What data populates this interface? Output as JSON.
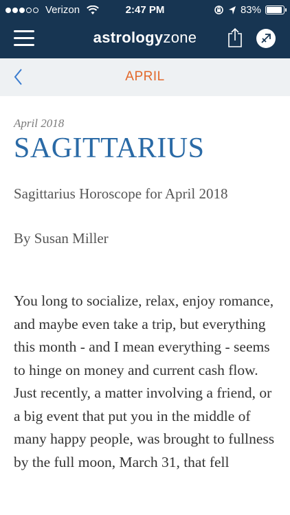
{
  "status_bar": {
    "carrier": "Verizon",
    "time": "2:47 PM",
    "battery": "83%",
    "battery_level": 0.83
  },
  "navbar": {
    "logo_part1": "astrology",
    "logo_part2": "zone",
    "menu_icon": "hamburger-menu-icon",
    "share_icon": "share-icon",
    "sign_icon": "sagittarius-icon"
  },
  "monthbar": {
    "month": "APRIL",
    "back_icon": "chevron-left-icon"
  },
  "article": {
    "date": "April 2018",
    "title": "SAGITTARIUS",
    "subtitle": "Sagittarius Horoscope for April 2018",
    "byline": "By Susan Miller",
    "body": "You long to socialize, relax, enjoy romance, and maybe even take a trip, but everything this month - and I mean everything - seems to hinge on money and current cash flow. Just recently, a matter involving a friend, or a big event that put you in the middle of many happy people, was brought to fullness by the full moon, March 31, that fell"
  },
  "colors": {
    "header_bg": "#173552",
    "month_accent": "#e2682b",
    "title_blue": "#2a6aa6",
    "month_bar_bg": "#eef1f3"
  }
}
